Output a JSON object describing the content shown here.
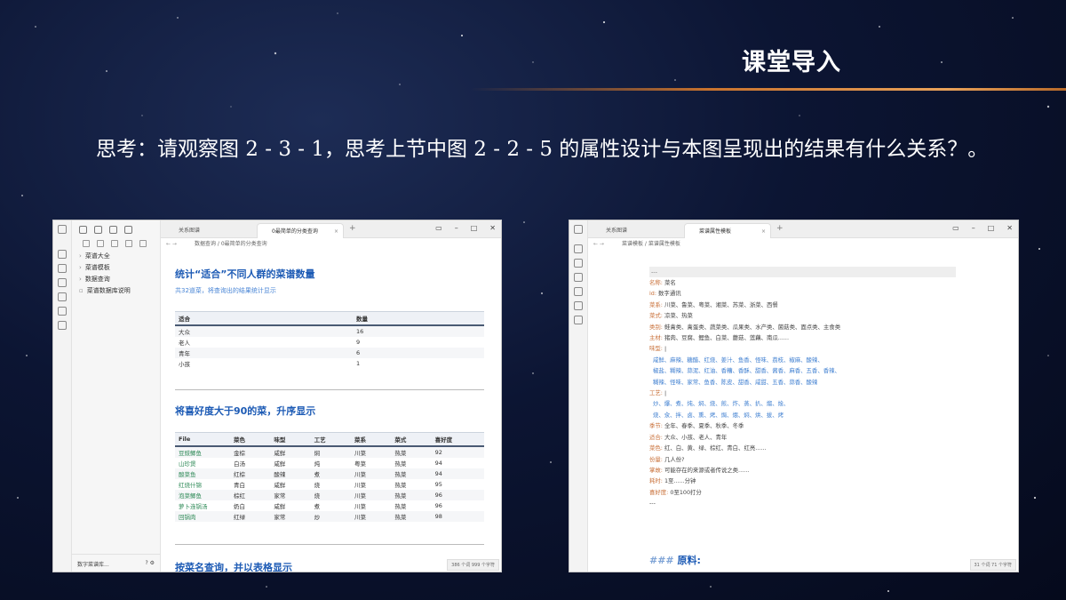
{
  "slide": {
    "title": "课堂导入",
    "question": "思考：请观察图 2 - 3 - 1，思考上节中图 2 - 2 - 5 的属性设计与本图呈现出的结果有什么关系？。"
  },
  "left_window": {
    "tabs": [
      {
        "label": "关系图谱",
        "close": ""
      },
      {
        "label": "0最简单的分类查询",
        "close": "×"
      }
    ],
    "breadcrumb": "数据查询 / 0最简单的分类查询",
    "tree": [
      {
        "label": "菜谱大全",
        "chevron": "›"
      },
      {
        "label": "菜谱模板",
        "chevron": "›"
      },
      {
        "label": "数据查询",
        "chevron": "›"
      },
      {
        "label": "菜谱数据库说明",
        "chevron": ""
      }
    ],
    "vault_name": "数字菜谱库...",
    "section1": {
      "heading": "统计“适合”不同人群的菜谱数量",
      "note": "共32道菜，将查询出的结果统计显示",
      "headers": [
        "适合",
        "数量"
      ],
      "rows": [
        [
          "大众",
          "16"
        ],
        [
          "老人",
          "9"
        ],
        [
          "青年",
          "6"
        ],
        [
          "小孩",
          "1"
        ]
      ]
    },
    "section2": {
      "heading": "将喜好度大于90的菜，升序显示",
      "headers": [
        "File",
        "菜色",
        "味型",
        "工艺",
        "菜系",
        "菜式",
        "喜好度"
      ],
      "rows": [
        [
          "豆豉鲫鱼",
          "金棕",
          "咸鲜",
          "焖",
          "川菜",
          "热菜",
          "92"
        ],
        [
          "山珍煲",
          "白汤",
          "咸鲜",
          "炖",
          "粤菜",
          "热菜",
          "94"
        ],
        [
          "酸菜鱼",
          "红棕",
          "酸辣",
          "煮",
          "川菜",
          "热菜",
          "94"
        ],
        [
          "红烧什锦",
          "青白",
          "咸鲜",
          "烧",
          "川菜",
          "热菜",
          "95"
        ],
        [
          "泡菜鲫鱼",
          "棕红",
          "家常",
          "烧",
          "川菜",
          "热菜",
          "96"
        ],
        [
          "萝卜连锅汤",
          "奶白",
          "咸鲜",
          "煮",
          "川菜",
          "热菜",
          "96"
        ],
        [
          "回锅肉",
          "红绿",
          "家常",
          "炒",
          "川菜",
          "热菜",
          "98"
        ]
      ]
    },
    "section3": {
      "heading": "按菜名查询，并以表格显示"
    },
    "status": "386 个词  999 个字符"
  },
  "right_window": {
    "tabs": [
      {
        "label": "关系图谱",
        "close": ""
      },
      {
        "label": "菜谱属性模板",
        "close": "×"
      }
    ],
    "breadcrumb": "菜谱模板 / 菜谱属性模板",
    "yaml": {
      "open": "---",
      "close": "---",
      "name_k": "名称:",
      "name_v": "菜名",
      "id_k": "id:",
      "id_v": "数字通讯",
      "cuisine_k": "菜系:",
      "cuisine_v": "川菜、鲁菜、粤菜、湘菜、苏菜、浙菜、西餐",
      "type_k": "菜式:",
      "type_v": "凉菜、热菜",
      "category_k": "类别:",
      "category_v": "鲑禽类、禽蛋类、蔬菜类、瓜果类、水产类、菌菇类、面点类、主食类",
      "ingredient_k": "主材:",
      "ingredient_v": "猪肉、豆腐、鲤鱼、白菜、蘑菇、莲藕、南瓜......",
      "flavor_k": "味型:",
      "flavor_v": "|",
      "flavor_lines": [
        "咸鲜、麻辣、糖醋、红烧、姜汁、鱼香、怪味、荔枝、椒麻、酸辣、",
        "椒盐、糊辣、蒜泥、红油、香糟、香酥、甜香、酱香、麻香、五香、香辣、",
        "糊辣、怪味、家常、鱼香、陈皮、甜香、咸甜、五香、蒜香、酸辣"
      ],
      "craft_k": "工艺:",
      "craft_v": "|",
      "craft_lines": [
        "炒、爆、煮、炖、焖、烧、煎、炸、蒸、扒、熘、烩、",
        "烧、汆、拌、卤、熏、烤、焗、煨、焖、烘、拔、烤"
      ],
      "season_k": "季节:",
      "season_v": "全年、春季、夏季、秋季、冬季",
      "suit_k": "适合:",
      "suit_v": "大众、小孩、老人、青年",
      "color_k": "菜色:",
      "color_v": "红、白、黄、绿、棕红、青白、红亮......",
      "portion_k": "份量:",
      "portion_v": "几人份?",
      "story_k": "掌故:",
      "story_v": "可能存在的来源或者传说之类......",
      "time_k": "耗时:",
      "time_v": "1至......分钟",
      "pref_k": "喜好度:",
      "pref_v": "0至100打分"
    },
    "heading": "原料:",
    "heading_hash": "###",
    "status": "31 个词  71 个字符"
  }
}
